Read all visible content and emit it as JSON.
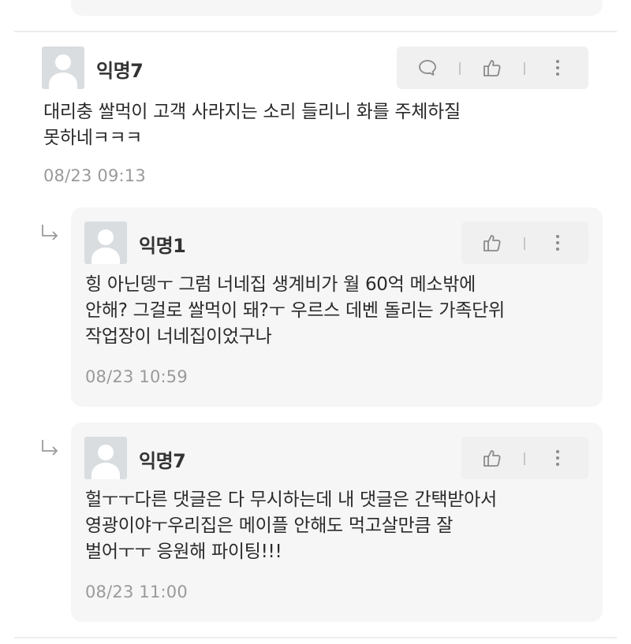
{
  "comments": [
    {
      "username": "익명7",
      "body": "대리충 쌀먹이 고객 사라지는 소리 들리니 화를 주체하질\n못하네ㅋㅋㅋ",
      "timestamp": "08/23 09:13",
      "actions": [
        "speech-bubble-icon",
        "thumbs-up-icon",
        "more-vertical-icon"
      ]
    }
  ],
  "replies": [
    {
      "username": "익명1",
      "body": "힝 아닌뎅ㅜ 그럼 너네집 생계비가 월 60억 메소밖에\n안해? 그걸로 쌀먹이 돼?ㅜ 우르스 데벤 돌리는 가족단위\n작업장이 너네집이었구나",
      "timestamp": "08/23 10:59",
      "actions": [
        "thumbs-up-icon",
        "more-vertical-icon"
      ]
    },
    {
      "username": "익명7",
      "body": "헐ㅜㅜ다른 댓글은 다 무시하는데 내 댓글은 간택받아서\n영광이야ㅜ우리집은 메이플 안해도 먹고살만큼 잘\n벌어ㅜㅜ 응원해 파이팅!!!",
      "timestamp": "08/23 11:00",
      "actions": [
        "thumbs-up-icon",
        "more-vertical-icon"
      ]
    }
  ],
  "colors": {
    "card_bg": "#f6f6f6",
    "action_bg": "#f0f0f0",
    "timestamp": "#9a9a9a",
    "icon": "#8a8a8a"
  }
}
